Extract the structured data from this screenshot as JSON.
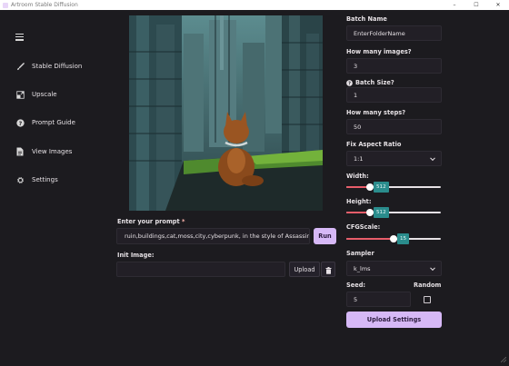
{
  "window": {
    "title": "Artroom Stable Diffusion",
    "controls": [
      "–",
      "☐",
      "✕"
    ]
  },
  "sidebar": {
    "items": [
      {
        "label": "Stable Diffusion",
        "icon": "brush-icon"
      },
      {
        "label": "Upscale",
        "icon": "upscale-icon"
      },
      {
        "label": "Prompt Guide",
        "icon": "question-circle-icon"
      },
      {
        "label": "View Images",
        "icon": "document-icon"
      },
      {
        "label": "Settings",
        "icon": "gear-icon"
      }
    ]
  },
  "prompt": {
    "label": "Enter your prompt",
    "required_mark": "*",
    "value": "ruin,buildings,cat,moss,city,cyberpunk, in the style of Assassin's Creed",
    "run_label": "Run"
  },
  "init_image": {
    "label": "Init Image:",
    "value": "",
    "upload_label": "Upload"
  },
  "settings": {
    "batch_name": {
      "label": "Batch Name",
      "value": "EnterFolderName"
    },
    "images": {
      "label": "How many images?",
      "value": "3"
    },
    "batch_size": {
      "label": "Batch Size?",
      "value": "1"
    },
    "steps": {
      "label": "How many steps?",
      "value": "50"
    },
    "aspect": {
      "label": "Fix Aspect Ratio",
      "value": "1:1"
    },
    "width": {
      "label": "Width:",
      "value": "512",
      "fraction": 0.25
    },
    "height": {
      "label": "Height:",
      "value": "512",
      "fraction": 0.25
    },
    "cfg": {
      "label": "CFGScale:",
      "value": "15",
      "fraction": 0.5
    },
    "sampler": {
      "label": "Sampler",
      "value": "k_lms"
    },
    "seed": {
      "label": "Seed:",
      "value": "5"
    },
    "random": {
      "label": "Random",
      "checked": false
    },
    "upload_settings_label": "Upload Settings"
  },
  "colors": {
    "accent": "#d6b8f6",
    "slider_fill": "#e85d6a",
    "slider_value": "#2a8c8c",
    "background": "#1c1b1f"
  }
}
